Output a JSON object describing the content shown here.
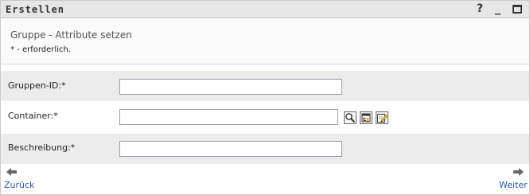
{
  "window": {
    "title": "Erstellen",
    "help_label": "?",
    "minimize_label": "_"
  },
  "header": {
    "subtitle": "Gruppe - Attribute setzen",
    "required_note": "* - erforderlich."
  },
  "form": {
    "group_id": {
      "label": "Gruppen-ID:*",
      "value": ""
    },
    "container": {
      "label": "Container:*",
      "value": ""
    },
    "description": {
      "label": "Beschreibung:*",
      "value": ""
    }
  },
  "icons": {
    "container_search": "magnifier-icon",
    "container_browse": "object-browser-icon",
    "container_edit": "edit-pencil-icon",
    "back_arrow": "arrow-left-icon",
    "next_arrow": "arrow-right-icon"
  },
  "navigation": {
    "back_label": "Zurück",
    "next_label": "Weiter"
  },
  "colors": {
    "titlebar_bg": "#e6e6e6",
    "row_shade": "#ececec",
    "link": "#2a5db0"
  }
}
